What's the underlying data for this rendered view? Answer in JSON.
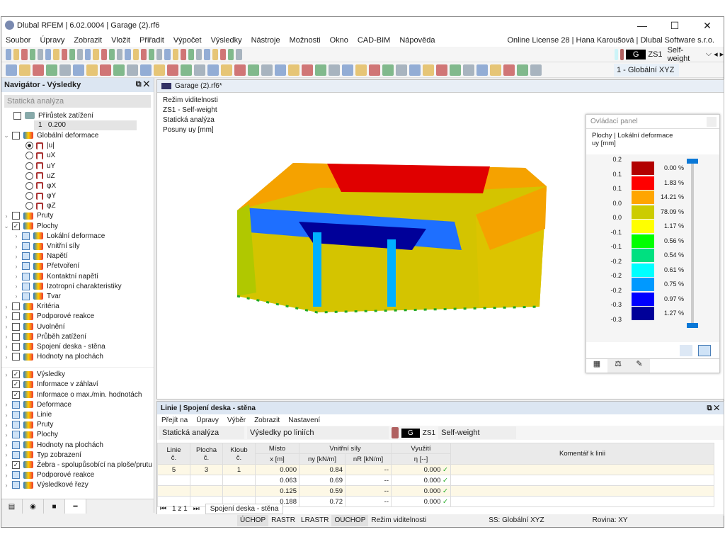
{
  "window": {
    "title": "Dlubal RFEM | 6.02.0004 | Garage (2).rf6",
    "minimize": "—",
    "maximize": "☐",
    "close": "✕"
  },
  "menu": [
    "Soubor",
    "Úpravy",
    "Zobrazit",
    "Vložit",
    "Přiřadit",
    "Výpočet",
    "Výsledky",
    "Nástroje",
    "Možnosti",
    "Okno",
    "CAD-BIM",
    "Nápověda"
  ],
  "license": "Online License 28 | Hana Karoušová | Dlubal Software s.r.o.",
  "toolbar": {
    "lc_badge": "G",
    "lc_code": "ZS1",
    "lc_name": "Self-weight",
    "coord_system": "1 - Globální XYZ"
  },
  "navigator": {
    "title": "Navigátor - Výsledky",
    "analysis": "Statická analýza",
    "increment_label": "Přírůstek zatížení",
    "increment_index": "1",
    "increment_value": "0.200",
    "items": [
      {
        "label": "Globální deformace",
        "exp": "v",
        "cb": "",
        "indent": 0
      },
      {
        "label": "|u|",
        "radio": true,
        "on": true,
        "indent": 1
      },
      {
        "label": "uX",
        "radio": true,
        "indent": 1
      },
      {
        "label": "uY",
        "radio": true,
        "indent": 1
      },
      {
        "label": "uZ",
        "radio": true,
        "indent": 1
      },
      {
        "label": "φX",
        "radio": true,
        "indent": 1
      },
      {
        "label": "φY",
        "radio": true,
        "indent": 1
      },
      {
        "label": "φZ",
        "radio": true,
        "indent": 1
      },
      {
        "label": "Pruty",
        "exp": ">",
        "cb": "",
        "indent": 0
      },
      {
        "label": "Plochy",
        "exp": "v",
        "cb": "✓",
        "indent": 0
      },
      {
        "label": "Lokální deformace",
        "exp": ">",
        "cb": "b",
        "indent": 1
      },
      {
        "label": "Vnitřní síly",
        "exp": ">",
        "cb": "b",
        "indent": 1
      },
      {
        "label": "Napětí",
        "exp": ">",
        "cb": "b",
        "indent": 1
      },
      {
        "label": "Přetvoření",
        "exp": ">",
        "cb": "b",
        "indent": 1
      },
      {
        "label": "Kontaktní napětí",
        "exp": ">",
        "cb": "b",
        "indent": 1
      },
      {
        "label": "Izotropní charakteristiky",
        "exp": ">",
        "cb": "b",
        "indent": 1
      },
      {
        "label": "Tvar",
        "exp": ">",
        "cb": "b",
        "indent": 1
      },
      {
        "label": "Kritéria",
        "exp": ">",
        "cb": "",
        "indent": 0
      },
      {
        "label": "Podporové reakce",
        "exp": ">",
        "cb": "",
        "indent": 0
      },
      {
        "label": "Uvolnění",
        "exp": ">",
        "cb": "",
        "indent": 0
      },
      {
        "label": "Průběh zatížení",
        "exp": ">",
        "cb": "",
        "indent": 0
      },
      {
        "label": "Spojení deska - stěna",
        "exp": ">",
        "cb": "",
        "indent": 0
      },
      {
        "label": "Hodnoty na plochách",
        "exp": ">",
        "cb": "",
        "indent": 0
      }
    ],
    "items2": [
      {
        "label": "Výsledky",
        "exp": ">",
        "cb": "✓"
      },
      {
        "label": "Informace v záhlaví",
        "exp": "",
        "cb": "✓"
      },
      {
        "label": "Informace o max./min. hodnotách",
        "exp": "",
        "cb": "✓"
      },
      {
        "label": "Deformace",
        "exp": ">",
        "cb": "b"
      },
      {
        "label": "Linie",
        "exp": ">",
        "cb": "b"
      },
      {
        "label": "Pruty",
        "exp": ">",
        "cb": "b"
      },
      {
        "label": "Plochy",
        "exp": ">",
        "cb": "b"
      },
      {
        "label": "Hodnoty na plochách",
        "exp": ">",
        "cb": "b"
      },
      {
        "label": "Typ zobrazení",
        "exp": ">",
        "cb": "b"
      },
      {
        "label": "Žebra - spolupůsobící na ploše/prutu",
        "exp": ">",
        "cb": "✓"
      },
      {
        "label": "Podporové reakce",
        "exp": ">",
        "cb": "b"
      },
      {
        "label": "Výsledkové řezy",
        "exp": ">",
        "cb": "b"
      }
    ]
  },
  "view": {
    "tab": "Garage (2).rf6*",
    "info": [
      "Režim viditelnosti",
      "ZS1 - Self-weight",
      "Statická analýza",
      "Posuny uy [mm]"
    ]
  },
  "control_panel": {
    "title": "Ovládací panel",
    "heading": "Plochy | Lokální deformace",
    "unit": "uy [mm]",
    "values": [
      "0.2",
      "0.1",
      "0.1",
      "0.0",
      "0.0",
      "-0.1",
      "-0.1",
      "-0.2",
      "-0.2",
      "-0.2",
      "-0.3",
      "-0.3"
    ],
    "bands": [
      {
        "color": "#b20000",
        "pct": "0.00 %"
      },
      {
        "color": "#ff0000",
        "pct": "1.83 %"
      },
      {
        "color": "#ffa500",
        "pct": "14.21 %"
      },
      {
        "color": "#cccc00",
        "pct": "78.09 %"
      },
      {
        "color": "#ffff00",
        "pct": "1.17 %"
      },
      {
        "color": "#00ff00",
        "pct": "0.56 %"
      },
      {
        "color": "#00e080",
        "pct": "0.54 %"
      },
      {
        "color": "#00ffff",
        "pct": "0.61 %"
      },
      {
        "color": "#0099ff",
        "pct": "0.75 %"
      },
      {
        "color": "#0000ff",
        "pct": "0.97 %"
      },
      {
        "color": "#000099",
        "pct": "1.27 %"
      }
    ]
  },
  "bottom": {
    "title": "Linie | Spojení deska - stěna",
    "menu": [
      "Přejít na",
      "Úpravy",
      "Výběr",
      "Zobrazit",
      "Nastavení"
    ],
    "analysis": "Statická analýza",
    "results": "Výsledky po liniích",
    "lc_badge": "G",
    "lc_code": "ZS1",
    "lc_name": "Self-weight",
    "headers": {
      "line": "Linie\nč.",
      "surface": "Plocha\nč.",
      "hinge": "Kloub\nč.",
      "loc_group": "Místo",
      "loc": "x [m]",
      "forces": "Vnitřní síly",
      "ny": "ny [kN/m]",
      "nr": "nR [kN/m]",
      "util": "Využití",
      "eta": "η [--]",
      "comment": "Komentář k linii"
    },
    "rows": [
      {
        "line": "5",
        "surface": "3",
        "hinge": "1",
        "x": "0.000",
        "ny": "0.84",
        "nr": "--",
        "eta": "0.000"
      },
      {
        "line": "",
        "surface": "",
        "hinge": "",
        "x": "0.063",
        "ny": "0.69",
        "nr": "--",
        "eta": "0.000"
      },
      {
        "line": "",
        "surface": "",
        "hinge": "",
        "x": "0.125",
        "ny": "0.59",
        "nr": "--",
        "eta": "0.000"
      },
      {
        "line": "",
        "surface": "",
        "hinge": "",
        "x": "0.188",
        "ny": "0.72",
        "nr": "--",
        "eta": "0.000"
      }
    ],
    "pager": "1 z 1",
    "sheet_tab": "Spojení deska - stěna"
  },
  "status": [
    "ÚCHOP",
    "RASTR",
    "LRASTR",
    "OUCHOP",
    "Režim viditelnosti",
    "SS: Globální XYZ",
    "Rovina: XY"
  ]
}
